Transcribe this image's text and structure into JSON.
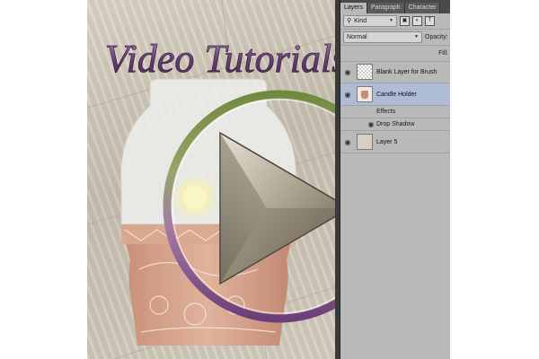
{
  "title": "Video Tutorials",
  "panel": {
    "tabs": [
      {
        "label": "Layers",
        "active": true
      },
      {
        "label": "Paragraph",
        "active": false
      },
      {
        "label": "Character",
        "active": false
      }
    ],
    "filter": {
      "kind_label": "Kind",
      "search_icon": "search-icon",
      "filter_icons": [
        "image-filter-icon",
        "adjustment-filter-icon",
        "type-filter-icon"
      ],
      "type_glyph": "T"
    },
    "blend": {
      "mode": "Normal",
      "opacity_label": "Opacity:"
    },
    "lock": {
      "fill_label": "Fill:"
    },
    "layers": [
      {
        "name": "Blank Layer for Brush",
        "visible": true,
        "selected": false,
        "thumb": "transparent"
      },
      {
        "name": "Candle Holder",
        "visible": true,
        "selected": true,
        "thumb": "candle"
      },
      {
        "name": "Layer 5",
        "visible": true,
        "selected": false,
        "thumb": "layer5"
      }
    ],
    "effects": {
      "label": "Effects",
      "drop_shadow": "Drop Shadow"
    }
  },
  "colors": {
    "panel_bg": "#b9b9b9",
    "selected_row": "#aebcd8",
    "title_purple": "#6b3f78",
    "ring_green": "#7c8f4a",
    "ring_purple": "#7a4a84",
    "pot_terracotta": "#c9937b"
  },
  "play_icon": "play-button-icon"
}
